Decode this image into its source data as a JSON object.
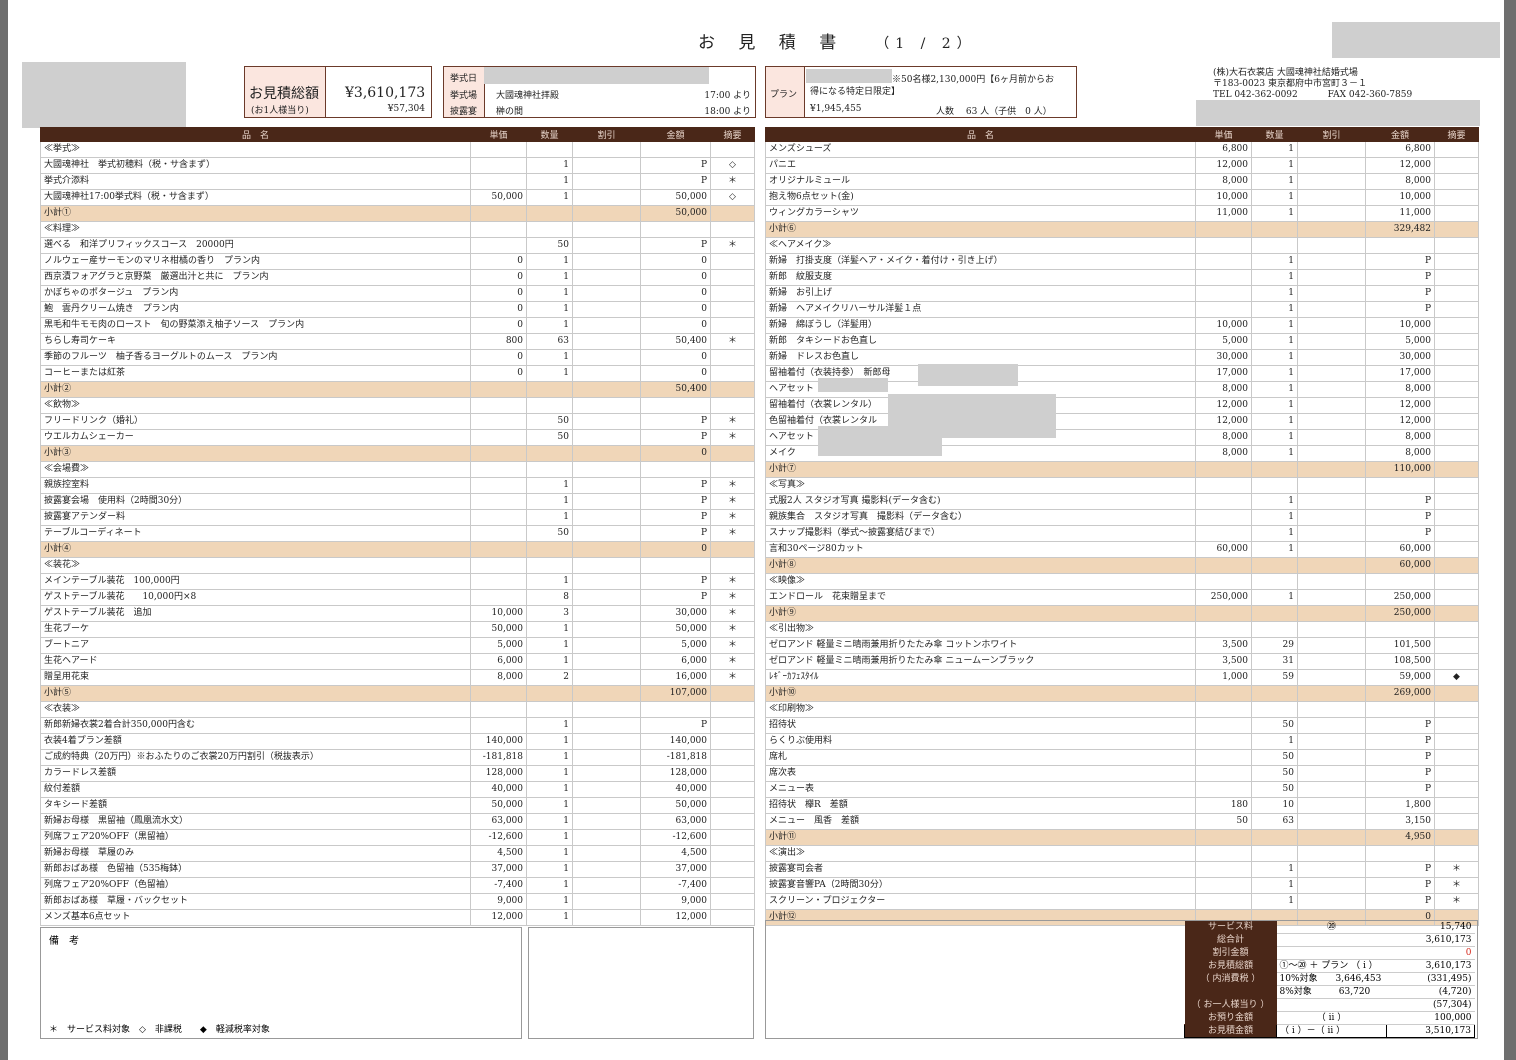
{
  "title": "お 見 積 書",
  "page": "（1 / 2）",
  "total_box": {
    "label": "お見積総額",
    "sub_label": "(お1人様当り)",
    "amount": "¥3,610,173",
    "per_person": "¥57,304"
  },
  "venue_box": {
    "r1_label": "挙式日",
    "r2_label": "挙式場",
    "r2_value": "大國魂神社拝殿",
    "r2_time": "17:00 より",
    "r3_label": "披露宴",
    "r3_value": "榊の間",
    "r3_time": "18:00 より"
  },
  "plan_box": {
    "label": "プラン",
    "text1": "※50名様2,130,000円【6ヶ月前からお",
    "text2": "得になる特定日限定】",
    "price": "¥1,945,455",
    "guests": "人数　 63 人（子供　0 人）"
  },
  "company": {
    "line1": "(株)大石衣裳店 大國魂神社結婚式場",
    "line2": "〒183-0023 東京都府中市宮町３－１",
    "line3": "TEL 042-362-0092　　　 FAX 042-360-7859"
  },
  "headers": [
    "品　名",
    "単価",
    "数量",
    "割引",
    "金額",
    "摘要"
  ],
  "left_rows": [
    [
      "≪挙式≫",
      "",
      "",
      "",
      "",
      "",
      ""
    ],
    [
      "大國魂神社　挙式初穂料（税・サ含まず）",
      "",
      "1",
      "",
      "P",
      "◇",
      ""
    ],
    [
      "挙式介添料",
      "",
      "1",
      "",
      "P",
      "＊",
      ""
    ],
    [
      "大國魂神社17:00挙式料（税・サ含まず）",
      "50,000",
      "1",
      "",
      "50,000",
      "◇",
      ""
    ],
    [
      "小計①",
      "",
      "",
      "",
      "50,000",
      "",
      "sub"
    ],
    [
      "≪料理≫",
      "",
      "",
      "",
      "",
      "",
      ""
    ],
    [
      "選べる　和洋プリフィックスコース　20000円",
      "",
      "50",
      "",
      "P",
      "＊",
      ""
    ],
    [
      "ノルウェー産サーモンのマリネ柑橘の香り　プラン内",
      "0",
      "1",
      "",
      "0",
      "",
      ""
    ],
    [
      "西京漬フォアグラと京野菜　厳選出汁と共に　プラン内",
      "0",
      "1",
      "",
      "0",
      "",
      ""
    ],
    [
      "かぼちゃのポタージュ　プラン内",
      "0",
      "1",
      "",
      "0",
      "",
      ""
    ],
    [
      "鮑　雲丹クリーム焼き　プラン内",
      "0",
      "1",
      "",
      "0",
      "",
      ""
    ],
    [
      "黒毛和牛モモ肉のロースト　旬の野菜添え柚子ソース　プラン内",
      "0",
      "1",
      "",
      "0",
      "",
      ""
    ],
    [
      "ちらし寿司ケーキ",
      "800",
      "63",
      "",
      "50,400",
      "＊",
      ""
    ],
    [
      "季節のフルーツ　柚子香るヨーグルトのムース　プラン内",
      "0",
      "1",
      "",
      "0",
      "",
      ""
    ],
    [
      "コーヒーまたは紅茶",
      "0",
      "1",
      "",
      "0",
      "",
      ""
    ],
    [
      "小計②",
      "",
      "",
      "",
      "50,400",
      "",
      "sub"
    ],
    [
      "≪飲物≫",
      "",
      "",
      "",
      "",
      "",
      ""
    ],
    [
      "フリードリンク（婚礼）",
      "",
      "50",
      "",
      "P",
      "＊",
      ""
    ],
    [
      "ウエルカムシェーカー",
      "",
      "50",
      "",
      "P",
      "＊",
      ""
    ],
    [
      "小計③",
      "",
      "",
      "",
      "0",
      "",
      "sub"
    ],
    [
      "≪会場費≫",
      "",
      "",
      "",
      "",
      "",
      ""
    ],
    [
      "親族控室料",
      "",
      "1",
      "",
      "P",
      "＊",
      ""
    ],
    [
      "披露宴会場　使用料（2時間30分）",
      "",
      "1",
      "",
      "P",
      "＊",
      ""
    ],
    [
      "披露宴アテンダー料",
      "",
      "1",
      "",
      "P",
      "＊",
      ""
    ],
    [
      "テーブルコーディネート",
      "",
      "50",
      "",
      "P",
      "＊",
      ""
    ],
    [
      "小計④",
      "",
      "",
      "",
      "0",
      "",
      "sub"
    ],
    [
      "≪装花≫",
      "",
      "",
      "",
      "",
      "",
      ""
    ],
    [
      "メインテーブル装花　100,000円",
      "",
      "1",
      "",
      "P",
      "＊",
      ""
    ],
    [
      "ゲストテーブル装花　　10,000円×8",
      "",
      "8",
      "",
      "P",
      "＊",
      ""
    ],
    [
      "ゲストテーブル装花　追加",
      "10,000",
      "3",
      "",
      "30,000",
      "＊",
      ""
    ],
    [
      "生花ブーケ",
      "50,000",
      "1",
      "",
      "50,000",
      "＊",
      ""
    ],
    [
      "ブートニア",
      "5,000",
      "1",
      "",
      "5,000",
      "＊",
      ""
    ],
    [
      "生花ヘアード",
      "6,000",
      "1",
      "",
      "6,000",
      "＊",
      ""
    ],
    [
      "贈呈用花束",
      "8,000",
      "2",
      "",
      "16,000",
      "＊",
      ""
    ],
    [
      "小計⑤",
      "",
      "",
      "",
      "107,000",
      "",
      "sub"
    ],
    [
      "≪衣装≫",
      "",
      "",
      "",
      "",
      "",
      ""
    ],
    [
      "新郎新婦衣裳2着合計350,000円含む",
      "",
      "1",
      "",
      "P",
      "",
      ""
    ],
    [
      "衣装4着プラン差額",
      "140,000",
      "1",
      "",
      "140,000",
      "",
      ""
    ],
    [
      "ご成約特典（20万円）※おふたりのご衣裳20万円割引（税抜表示）",
      "-181,818",
      "1",
      "",
      "-181,818",
      "",
      ""
    ],
    [
      "カラードレス差額",
      "128,000",
      "1",
      "",
      "128,000",
      "",
      ""
    ],
    [
      "紋付差額",
      "40,000",
      "1",
      "",
      "40,000",
      "",
      ""
    ],
    [
      "タキシード差額",
      "50,000",
      "1",
      "",
      "50,000",
      "",
      ""
    ],
    [
      "新婦お母様　黒留袖（鳳凰流水文）",
      "63,000",
      "1",
      "",
      "63,000",
      "",
      ""
    ],
    [
      "列席フェア20%OFF（黒留袖）",
      "-12,600",
      "1",
      "",
      "-12,600",
      "",
      ""
    ],
    [
      "新婦お母様　草履のみ",
      "4,500",
      "1",
      "",
      "4,500",
      "",
      ""
    ],
    [
      "新郎おばあ様　色留袖（535梅鉢）",
      "37,000",
      "1",
      "",
      "37,000",
      "",
      ""
    ],
    [
      "列席フェア20%OFF（色留袖）",
      "-7,400",
      "1",
      "",
      "-7,400",
      "",
      ""
    ],
    [
      "新郎おばあ様　草履・バックセット",
      "9,000",
      "1",
      "",
      "9,000",
      "",
      ""
    ],
    [
      "メンズ基本6点セット",
      "12,000",
      "1",
      "",
      "12,000",
      "",
      ""
    ]
  ],
  "right_rows": [
    [
      "メンズシューズ",
      "6,800",
      "1",
      "",
      "6,800",
      "",
      ""
    ],
    [
      "パニエ",
      "12,000",
      "1",
      "",
      "12,000",
      "",
      ""
    ],
    [
      "オリジナルミュール",
      "8,000",
      "1",
      "",
      "8,000",
      "",
      ""
    ],
    [
      "抱え物6点セット(金)",
      "10,000",
      "1",
      "",
      "10,000",
      "",
      ""
    ],
    [
      "ウィングカラーシャツ",
      "11,000",
      "1",
      "",
      "11,000",
      "",
      ""
    ],
    [
      "小計⑥",
      "",
      "",
      "",
      "329,482",
      "",
      "sub"
    ],
    [
      "≪ヘアメイク≫",
      "",
      "",
      "",
      "",
      "",
      ""
    ],
    [
      "新婦　打掛支度（洋髪ヘア・メイク・着付け・引き上げ）",
      "",
      "1",
      "",
      "P",
      "",
      ""
    ],
    [
      "新郎　紋服支度",
      "",
      "1",
      "",
      "P",
      "",
      ""
    ],
    [
      "新婦　お引上げ",
      "",
      "1",
      "",
      "P",
      "",
      ""
    ],
    [
      "新婦　ヘアメイクリハーサル洋髪１点",
      "",
      "1",
      "",
      "P",
      "",
      ""
    ],
    [
      "新婦　綿ぼうし（洋髪用）",
      "10,000",
      "1",
      "",
      "10,000",
      "",
      ""
    ],
    [
      "新郎　タキシードお色直し",
      "5,000",
      "1",
      "",
      "5,000",
      "",
      ""
    ],
    [
      "新婦　ドレスお色直し",
      "30,000",
      "1",
      "",
      "30,000",
      "",
      ""
    ],
    [
      "留袖着付（衣装持参）　新郎母",
      "17,000",
      "1",
      "",
      "17,000",
      "",
      ""
    ],
    [
      "ヘアセット",
      "8,000",
      "1",
      "",
      "8,000",
      "",
      ""
    ],
    [
      "留袖着付（衣裳レンタル）",
      "12,000",
      "1",
      "",
      "12,000",
      "",
      ""
    ],
    [
      "色留袖着付（衣裳レンタル",
      "12,000",
      "1",
      "",
      "12,000",
      "",
      ""
    ],
    [
      "ヘアセット",
      "8,000",
      "1",
      "",
      "8,000",
      "",
      ""
    ],
    [
      "メイク",
      "8,000",
      "1",
      "",
      "8,000",
      "",
      ""
    ],
    [
      "小計⑦",
      "",
      "",
      "",
      "110,000",
      "",
      "sub"
    ],
    [
      "≪写真≫",
      "",
      "",
      "",
      "",
      "",
      ""
    ],
    [
      "式服2人 スタジオ写真 撮影料(データ含む)",
      "",
      "1",
      "",
      "P",
      "",
      ""
    ],
    [
      "親族集合　スタジオ写真　撮影料（データ含む）",
      "",
      "1",
      "",
      "P",
      "",
      ""
    ],
    [
      "スナップ撮影料（挙式～披露宴結びまで）",
      "",
      "1",
      "",
      "P",
      "",
      ""
    ],
    [
      "言和30ページ80カット",
      "60,000",
      "1",
      "",
      "60,000",
      "",
      ""
    ],
    [
      "小計⑧",
      "",
      "",
      "",
      "60,000",
      "",
      "sub"
    ],
    [
      "≪映像≫",
      "",
      "",
      "",
      "",
      "",
      ""
    ],
    [
      "エンドロール　花束贈呈まで",
      "250,000",
      "1",
      "",
      "250,000",
      "",
      ""
    ],
    [
      "小計⑨",
      "",
      "",
      "",
      "250,000",
      "",
      "sub"
    ],
    [
      "≪引出物≫",
      "",
      "",
      "",
      "",
      "",
      ""
    ],
    [
      "ゼロアンド 軽量ミニ晴雨兼用折りたたみ傘 コットンホワイト",
      "3,500",
      "29",
      "",
      "101,500",
      "",
      ""
    ],
    [
      "ゼロアンド 軽量ミニ晴雨兼用折りたたみ傘 ニュームーンブラック",
      "3,500",
      "31",
      "",
      "108,500",
      "",
      ""
    ],
    [
      "ﾚｷﾞｰｶﾌｪｽﾀｲﾙ",
      "1,000",
      "59",
      "",
      "59,000",
      "◆",
      ""
    ],
    [
      "小計⑩",
      "",
      "",
      "",
      "269,000",
      "",
      "sub"
    ],
    [
      "≪印刷物≫",
      "",
      "",
      "",
      "",
      "",
      ""
    ],
    [
      "招待状",
      "",
      "50",
      "",
      "P",
      "",
      ""
    ],
    [
      "らくりぶ使用料",
      "",
      "1",
      "",
      "P",
      "",
      ""
    ],
    [
      "席札",
      "",
      "50",
      "",
      "P",
      "",
      ""
    ],
    [
      "席次表",
      "",
      "50",
      "",
      "P",
      "",
      ""
    ],
    [
      "メニュー表",
      "",
      "50",
      "",
      "P",
      "",
      ""
    ],
    [
      "招待状　欅R　差額",
      "180",
      "10",
      "",
      "1,800",
      "",
      ""
    ],
    [
      "メニュー　風香　差額",
      "50",
      "63",
      "",
      "3,150",
      "",
      ""
    ],
    [
      "小計⑪",
      "",
      "",
      "",
      "4,950",
      "",
      "sub"
    ],
    [
      "≪演出≫",
      "",
      "",
      "",
      "",
      "",
      ""
    ],
    [
      "披露宴司会者",
      "",
      "1",
      "",
      "P",
      "＊",
      ""
    ],
    [
      "披露宴音響PA（2時間30分）",
      "",
      "1",
      "",
      "P",
      "＊",
      ""
    ],
    [
      "スクリーン・プロジェクター",
      "",
      "1",
      "",
      "P",
      "＊",
      ""
    ],
    [
      "小計⑫",
      "",
      "",
      "",
      "0",
      "",
      "sub"
    ]
  ],
  "remarks": {
    "title": "備　考",
    "legend": "＊　サービス料対象　◇　非課税　　◆　軽減税率対象"
  },
  "summary": [
    [
      "サービス料",
      "⑳",
      "15,740"
    ],
    [
      "総合計",
      "",
      "3,610,173"
    ],
    [
      "割引金額",
      "",
      "0"
    ],
    [
      "お見積総額",
      "①～⑳ ＋ プラン （ i ）",
      "3,610,173"
    ],
    [
      "（ 内消費税 ）",
      "10%対象　　3,646,453",
      "(331,495)"
    ],
    [
      "",
      "8%対象　　　63,720",
      "(4,720)"
    ],
    [
      "（ お一人様当り ）",
      "",
      "(57,304)"
    ],
    [
      "お預り金額",
      "（ ii ）",
      "100,000"
    ],
    [
      "お見積金額",
      "（ i ）－（ ii ）",
      "3,510,173"
    ]
  ]
}
